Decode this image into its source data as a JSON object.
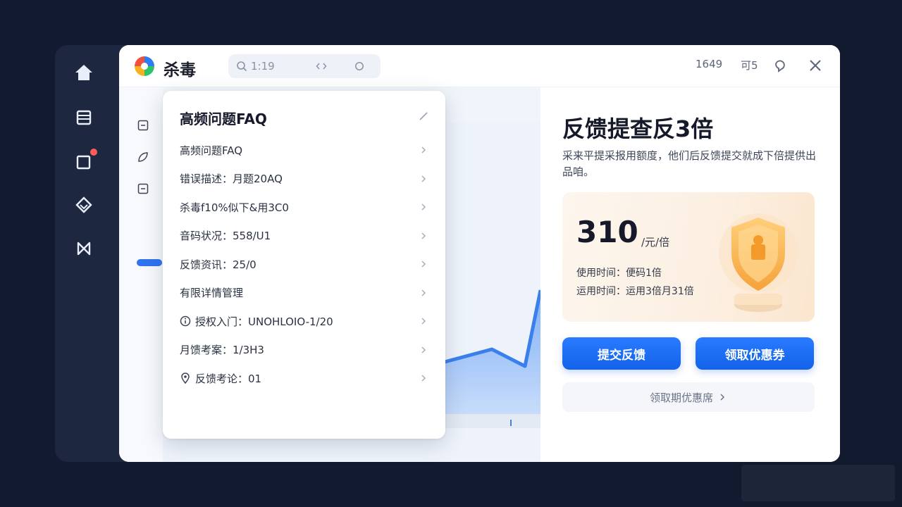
{
  "app": {
    "title": "杀毒"
  },
  "search": {
    "value": "1:19"
  },
  "titlebar": {
    "stat1": "1649",
    "stat2": "可5"
  },
  "faq": {
    "title": "高频问题FAQ",
    "items": [
      {
        "label": "高频问题FAQ",
        "icon": ""
      },
      {
        "label": "错误描述：月题20AQ",
        "icon": ""
      },
      {
        "label": "杀毒f10%似下&用3C0",
        "icon": ""
      },
      {
        "label": "音码状况：558/U1",
        "icon": ""
      },
      {
        "label": "反馈资讯：25/0",
        "icon": ""
      },
      {
        "label": "有限详情管理",
        "icon": ""
      },
      {
        "label": "授权入门：UNOHLOIO-1/20",
        "icon": "info-circle-icon"
      },
      {
        "label": "月馈考案：1/3H3",
        "icon": ""
      },
      {
        "label": "反馈考论：01",
        "icon": "location-pin-icon"
      }
    ]
  },
  "offer": {
    "title": "反馈提查反3倍",
    "description": "采来平提采报用额度，他们后反馈提交就成下倍提供出品咱。",
    "price": "310",
    "unit": "/元/倍",
    "usage_time": "使用时间：便码1倍",
    "valid_time": "运用时间：运用3倍月31倍",
    "submit_button": "提交反馈",
    "coupon_button": "领取优惠券",
    "link": "领取期优惠席"
  },
  "colors": {
    "accent": "#1a6ef5",
    "background": "#111a2e",
    "card": "#fdf3e7"
  }
}
